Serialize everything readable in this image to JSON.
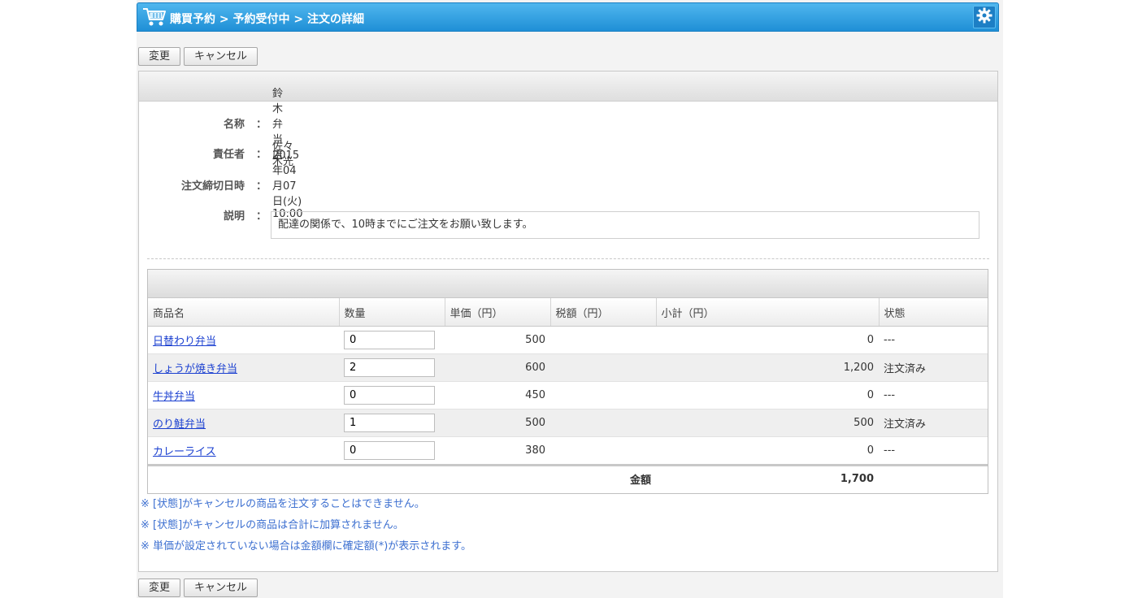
{
  "header": {
    "breadcrumb": "購買予約 > 予約受付中 > 注文の詳細",
    "icon": "shopping-cart-icon",
    "settings_icon": "gear-icon",
    "accent_color": "#1f8fd6"
  },
  "toolbar": {
    "change_label": "変更",
    "cancel_label": "キャンセル"
  },
  "info": {
    "name_label": "名称",
    "name_value": "鈴木弁当店",
    "manager_label": "責任者",
    "manager_value": "佐々木光",
    "deadline_label": "注文締切日時",
    "deadline_value": "2015年04月07日(火) 10:00",
    "description_label": "説明",
    "description_value": "配達の関係で、10時までにご注文をお願い致します。",
    "colon": "："
  },
  "table": {
    "columns": [
      "商品名",
      "数量",
      "単価（円）",
      "税額（円）",
      "小計（円）",
      "状態"
    ],
    "rows": [
      {
        "product": "日替わり弁当",
        "qty": "0",
        "price": "500",
        "tax": "",
        "subtotal": "0",
        "status": "---"
      },
      {
        "product": "しょうが焼き弁当",
        "qty": "2",
        "price": "600",
        "tax": "",
        "subtotal": "1,200",
        "status": "注文済み"
      },
      {
        "product": "牛丼弁当",
        "qty": "0",
        "price": "450",
        "tax": "",
        "subtotal": "0",
        "status": "---"
      },
      {
        "product": "のり鮭弁当",
        "qty": "1",
        "price": "500",
        "tax": "",
        "subtotal": "500",
        "status": "注文済み"
      },
      {
        "product": "カレーライス",
        "qty": "0",
        "price": "380",
        "tax": "",
        "subtotal": "0",
        "status": "---"
      }
    ],
    "total_label": "金額",
    "total_value": "1,700"
  },
  "notes": [
    "※ [状態]がキャンセルの商品を注文することはできません。",
    "※ [状態]がキャンセルの商品は合計に加算されません。",
    "※ 単価が設定されていない場合は金額欄に確定額(*)が表示されます。"
  ]
}
